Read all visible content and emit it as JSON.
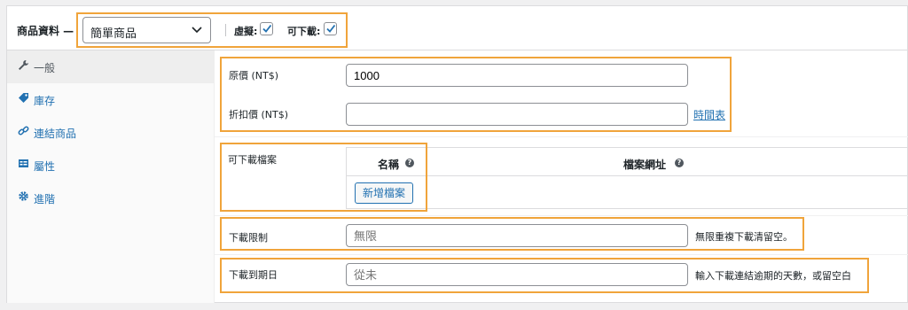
{
  "header": {
    "title": "商品資料 —",
    "product_type": "簡單商品",
    "virtual_label": "虛擬:",
    "virtual_checked": true,
    "downloadable_label": "可下載:",
    "downloadable_checked": true
  },
  "sidebar": {
    "items": [
      {
        "label": "一般",
        "icon": "wrench-icon",
        "active": true
      },
      {
        "label": "庫存",
        "icon": "tag-icon",
        "active": false
      },
      {
        "label": "連結商品",
        "icon": "link-icon",
        "active": false
      },
      {
        "label": "屬性",
        "icon": "table-icon",
        "active": false
      },
      {
        "label": "進階",
        "icon": "gear-icon",
        "active": false
      }
    ]
  },
  "pricing": {
    "regular_label": "原價 (NT$)",
    "regular_value": "1000",
    "sale_label": "折扣價 (NT$)",
    "sale_value": "",
    "schedule_link": "時間表"
  },
  "downloads": {
    "label": "可下載檔案",
    "col_name": "名稱",
    "col_url": "檔案網址",
    "add_button": "新增檔案"
  },
  "download_limit": {
    "label": "下載限制",
    "placeholder": "無限",
    "hint": "無限重複下載清留空。"
  },
  "download_expiry": {
    "label": "下載到期日",
    "placeholder": "從未",
    "hint": "輸入下載連結逾期的天數，或留空白"
  },
  "colors": {
    "highlight": "#f0a43b",
    "link": "#2271b1",
    "active_bg": "#eeeeee"
  }
}
